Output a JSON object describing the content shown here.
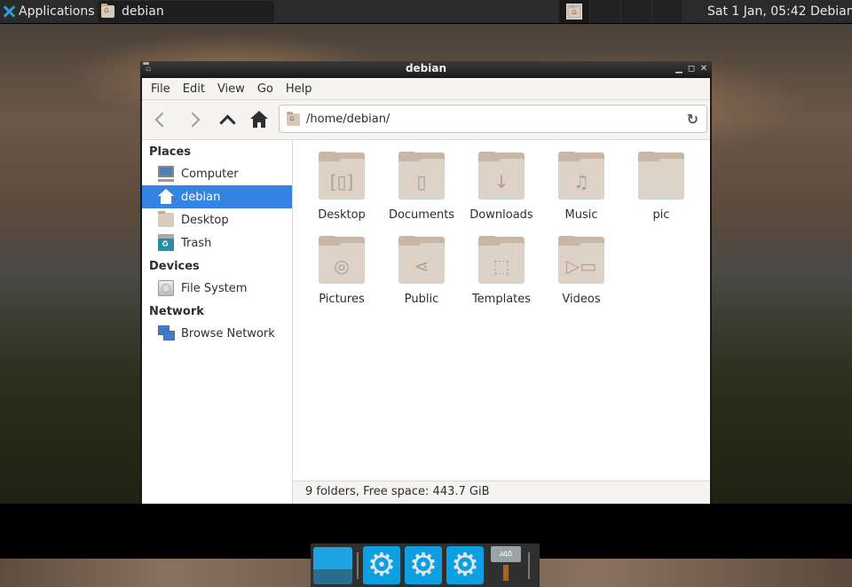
{
  "top_panel": {
    "applications_label": "Applications",
    "taskbar_window_label": "debian",
    "clock": "Sat  1 Jan, 05:42",
    "user": "Debian",
    "workspace_count": 4
  },
  "window": {
    "title": "debian",
    "menu": [
      "File",
      "Edit",
      "View",
      "Go",
      "Help"
    ],
    "location": "/home/debian/",
    "sidebar": {
      "sections": [
        {
          "heading": "Places",
          "items": [
            {
              "label": "Computer",
              "icon": "computer-icon"
            },
            {
              "label": "debian",
              "icon": "home-icon",
              "selected": true
            },
            {
              "label": "Desktop",
              "icon": "folder-desktop-icon"
            },
            {
              "label": "Trash",
              "icon": "trash-icon"
            }
          ]
        },
        {
          "heading": "Devices",
          "items": [
            {
              "label": "File System",
              "icon": "drive-icon"
            }
          ]
        },
        {
          "heading": "Network",
          "items": [
            {
              "label": "Browse Network",
              "icon": "network-icon"
            }
          ]
        }
      ]
    },
    "files": [
      {
        "name": "Desktop",
        "emblem": "desktop"
      },
      {
        "name": "Documents",
        "emblem": "document"
      },
      {
        "name": "Downloads",
        "emblem": "download"
      },
      {
        "name": "Music",
        "emblem": "music"
      },
      {
        "name": "pic",
        "emblem": ""
      },
      {
        "name": "Pictures",
        "emblem": "camera"
      },
      {
        "name": "Public",
        "emblem": "share"
      },
      {
        "name": "Templates",
        "emblem": "template"
      },
      {
        "name": "Videos",
        "emblem": "video"
      }
    ],
    "status": "9 folders, Free space: 443.7 GiB"
  },
  "dock": {
    "items": [
      "show-desktop",
      "settings",
      "settings",
      "settings",
      "tray-sign"
    ],
    "accent": "#0d9fe0"
  }
}
